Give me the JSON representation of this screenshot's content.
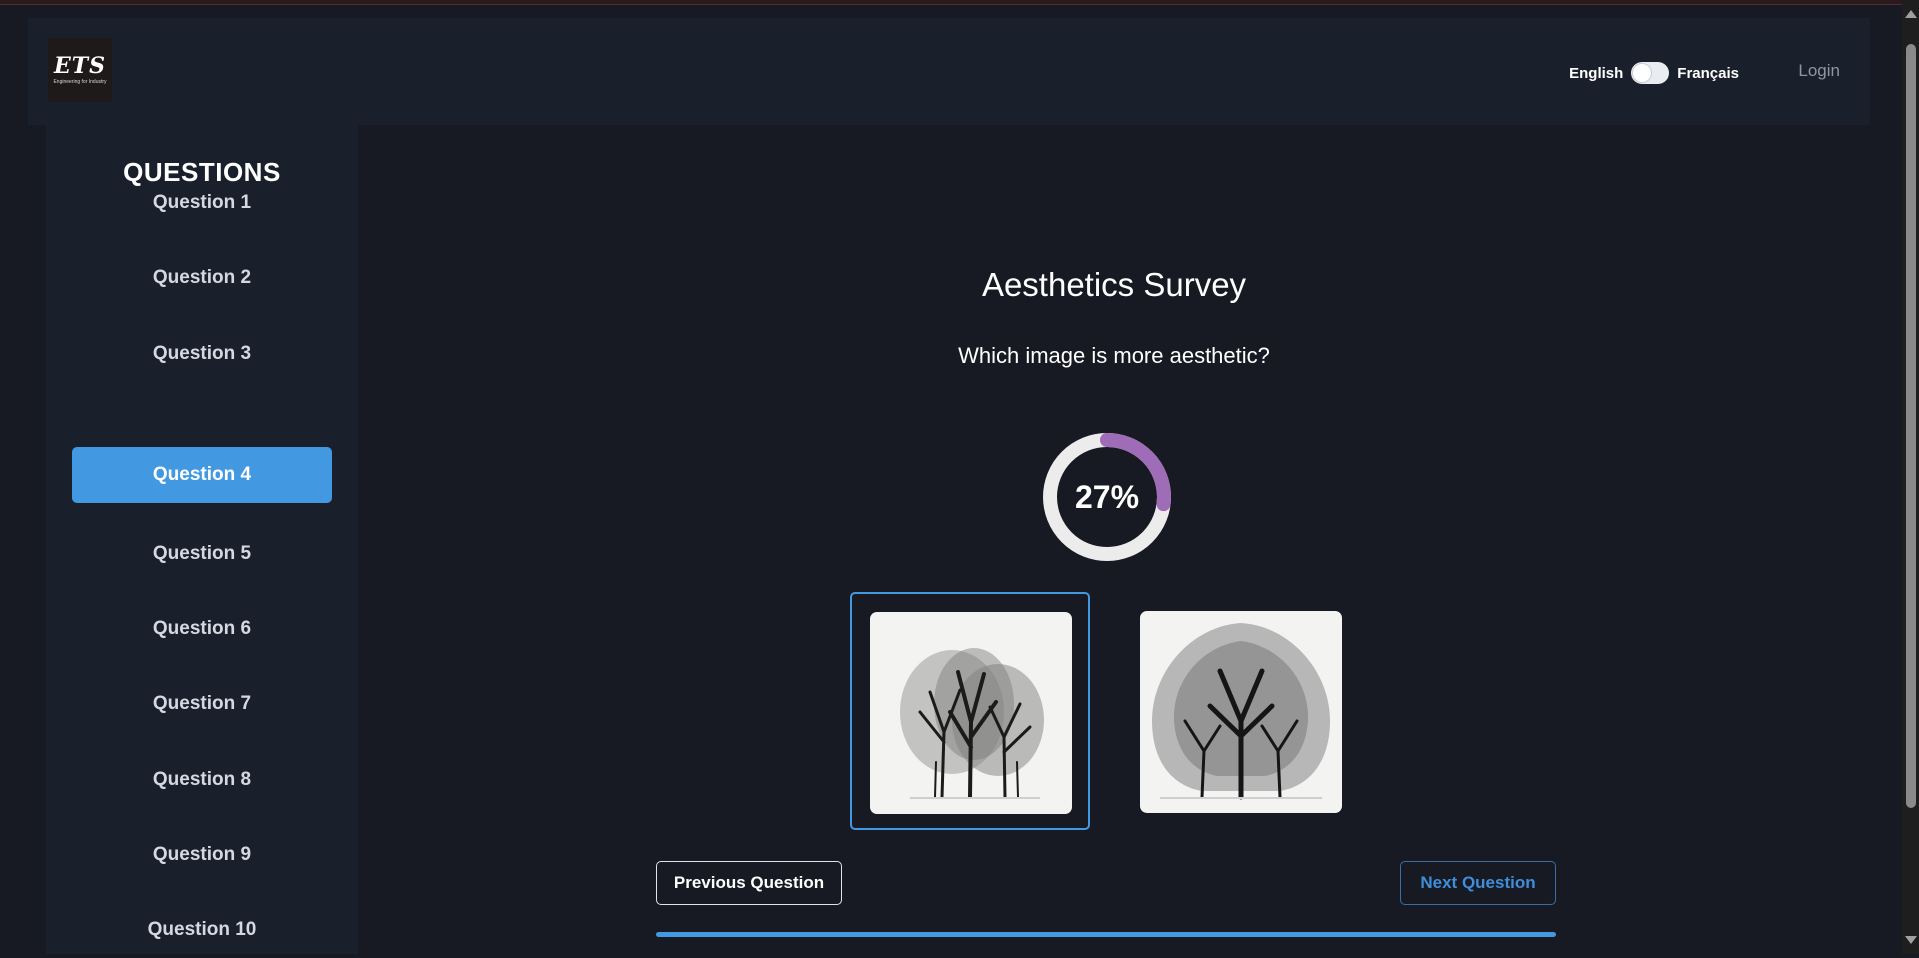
{
  "header": {
    "logo_text": "ETS",
    "logo_subtitle": "Engineering for Industry",
    "lang_left": "English",
    "lang_right": "Français",
    "login_label": "Login"
  },
  "sidebar": {
    "title": "QUESTIONS",
    "items": [
      {
        "label": "Question 1"
      },
      {
        "label": "Question 2"
      },
      {
        "label": "Question 3"
      },
      {
        "label": "Question 4",
        "active": true
      },
      {
        "label": "Question 5"
      },
      {
        "label": "Question 6"
      },
      {
        "label": "Question 7"
      },
      {
        "label": "Question 8"
      },
      {
        "label": "Question 9"
      },
      {
        "label": "Question 10"
      }
    ]
  },
  "survey": {
    "title": "Aesthetics Survey",
    "question": "Which image is more aesthetic?",
    "progress_value": 0.27,
    "progress_label": "27%",
    "images": [
      {
        "name": "tree-illustration-option-a",
        "selected": true
      },
      {
        "name": "tree-illustration-option-b",
        "selected": false
      }
    ],
    "prev_label": "Previous Question",
    "next_label": "Next Question"
  },
  "colors": {
    "accent": "#4299e1",
    "progress_arc": "#9f6cb8",
    "progress_track": "#ececec",
    "background": "#171a22",
    "panel": "#1a202b"
  }
}
